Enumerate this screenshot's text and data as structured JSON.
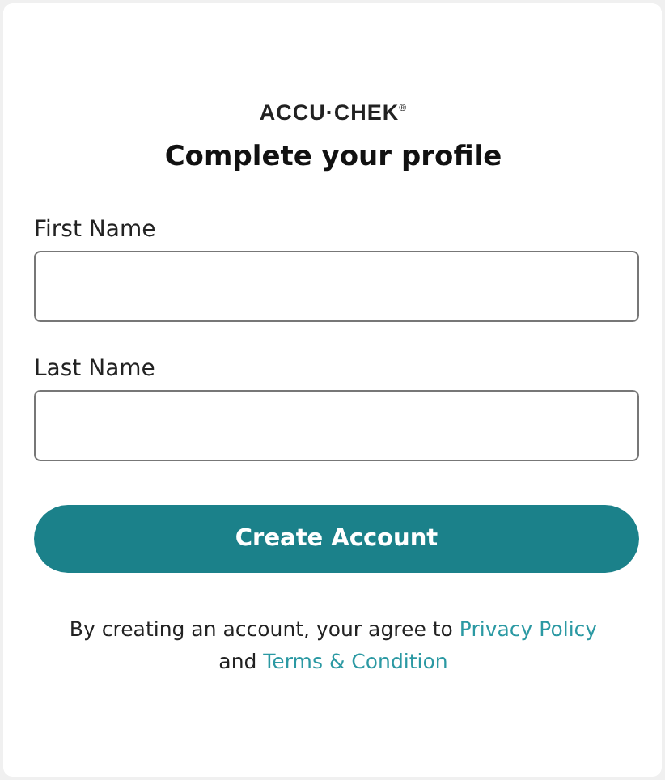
{
  "logo": "ACCU·CHEK$^{®}$",
  "title": "Complete your profile",
  "fields": [
    {
      "label": "First Name"
    },
    {
      "label": "Last Name"
    }
  ],
  "button": "Create Account",
  "agreement": {
    "text": "By creating an account, your agree to",
    "privacy_link": "Privacy Policy",
    "middle": "and",
    "terms_link": "Terms & Condition"
  }
}
